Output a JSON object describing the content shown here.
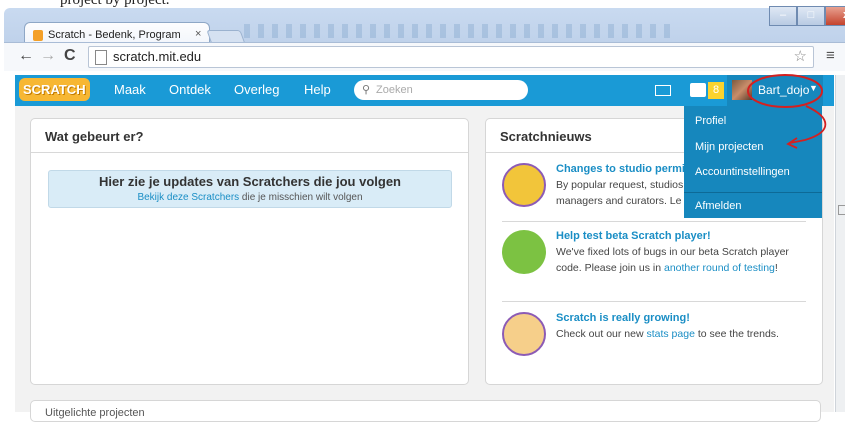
{
  "browser": {
    "top_strip_text": "project by project.",
    "tab_title": "Scratch - Bedenk, Program",
    "tab_close": "×",
    "url": "scratch.mit.edu",
    "minimize": "–",
    "maximize": "□",
    "close": "x"
  },
  "nav": {
    "logo": "SCRATCH",
    "items": [
      "Maak",
      "Ontdek",
      "Overleg",
      "Help"
    ],
    "search_placeholder": "Zoeken",
    "badge": "8",
    "username": "Bart_dojo"
  },
  "dropdown": {
    "items": [
      "Profiel",
      "Mijn projecten",
      "Accountinstellingen",
      "Afmelden"
    ]
  },
  "activity": {
    "title": "Wat gebeurt er?",
    "notice_main": "Hier zie je updates van Scratchers die jou volgen",
    "notice_link": "Bekijk deze Scratchers",
    "notice_rest": " die je misschien wilt volgen"
  },
  "news": {
    "title": "Scratchnieuws",
    "items": [
      {
        "title": "Changes to studio permi",
        "desc_1": "By popular request, studios",
        "desc_2": "managers and curators. Le"
      },
      {
        "title": "Help test beta Scratch player!",
        "desc_1": "We've fixed lots of bugs in our beta Scratch player code. Please join us in ",
        "desc_link": "another round of testing",
        "desc_2": "!"
      },
      {
        "title": "Scratch is really growing!",
        "desc_1": "Check out our new ",
        "desc_link": "stats page",
        "desc_2": " to see the trends."
      }
    ]
  },
  "bottom": {
    "title": "Uitgelichte projecten"
  }
}
